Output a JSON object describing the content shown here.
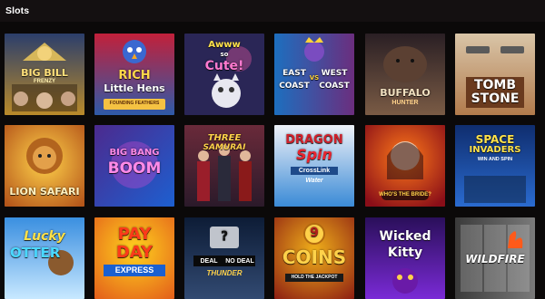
{
  "header": {
    "title": "Slots"
  },
  "games": [
    {
      "name": "Big Bill Frenzy",
      "l1": "BIG BILL",
      "l2": "FRENZY",
      "l3": "",
      "bg1": "#2b3e6b",
      "bg2": "#b98a2a"
    },
    {
      "name": "Rich Little Hens",
      "l1": "RICH",
      "l2": "Little Hens",
      "l3": "FOUNDING FEATHERS",
      "bg1": "#c2203a",
      "bg2": "#2e5aa8"
    },
    {
      "name": "Awww, So Cute!",
      "l1": "Awww",
      "l2": "so",
      "l3": "Cute!",
      "bg1": "#2a2656",
      "bg2": "#5a4aa0"
    },
    {
      "name": "East Coast vs West Coast",
      "l1": "EAST",
      "l2": "VS",
      "l3": "WEST",
      "l4": "COAST",
      "l5": "COAST",
      "bg1": "#1d6fbf",
      "bg2": "#6b2e7e"
    },
    {
      "name": "Buffalo Hunter",
      "l1": "BUFFALO",
      "l2": "HUNTER",
      "bg1": "#2a1f24",
      "bg2": "#7a5b45"
    },
    {
      "name": "Tombstone",
      "l1": "TOMB",
      "l2": "STONE",
      "bg1": "#d9c5a8",
      "bg2": "#b27b4c"
    },
    {
      "name": "Lion Safari",
      "l1": "LION SAFARI",
      "bg1": "#f0a429",
      "bg2": "#7a3a12"
    },
    {
      "name": "Big Bang Boom",
      "l1": "BIG BANG",
      "l2": "BOOM",
      "bg1": "#4c2a8e",
      "bg2": "#1d5fd0"
    },
    {
      "name": "Three Samurai",
      "l1": "THREE",
      "l2": "SAMURAI",
      "bg1": "#6a2a3a",
      "bg2": "#2b1a2a"
    },
    {
      "name": "Dragon Spin CrossLink Water",
      "l1": "DRAGON",
      "l2": "Spin",
      "l3": "CrossLink",
      "l4": "Water",
      "bg1": "#eff2f8",
      "bg2": "#3a8ad6"
    },
    {
      "name": "Who's the Bride?",
      "l1": "WHO'S THE BRIDE?",
      "bg1": "#c2202a",
      "bg2": "#ff7a1a"
    },
    {
      "name": "Space Invaders Win and Spin",
      "l1": "SPACE",
      "l2": "INVADERS",
      "l3": "WIN AND SPIN",
      "bg1": "#0f2d6e",
      "bg2": "#2a6bd0"
    },
    {
      "name": "Lucky Otter",
      "l1": "Lucky",
      "l2": "OTTER",
      "bg1": "#3a8fe0",
      "bg2": "#c8e8ff"
    },
    {
      "name": "Payday Express",
      "l1": "PAY",
      "l2": "DAY",
      "l3": "EXPRESS",
      "bg1": "#ffd21e",
      "bg2": "#e25a1a"
    },
    {
      "name": "Deal or No Deal Thunder",
      "l1": "DEAL",
      "l2": "NO DEAL",
      "l3": "THUNDER",
      "bg1": "#0d1c36",
      "bg2": "#324a72"
    },
    {
      "name": "9 Coins",
      "l1": "9",
      "l2": "COINS",
      "l3": "HOLD THE JACKPOT",
      "bg1": "#8a1a12",
      "bg2": "#f0b01a"
    },
    {
      "name": "Wicked Kitty",
      "l1": "Wicked",
      "l2": "Kitty",
      "bg1": "#2a0f5a",
      "bg2": "#7a2ad6"
    },
    {
      "name": "Wildfire",
      "l1": "WILDFIRE",
      "bg1": "#3a3a3a",
      "bg2": "#7a7a7a"
    }
  ]
}
